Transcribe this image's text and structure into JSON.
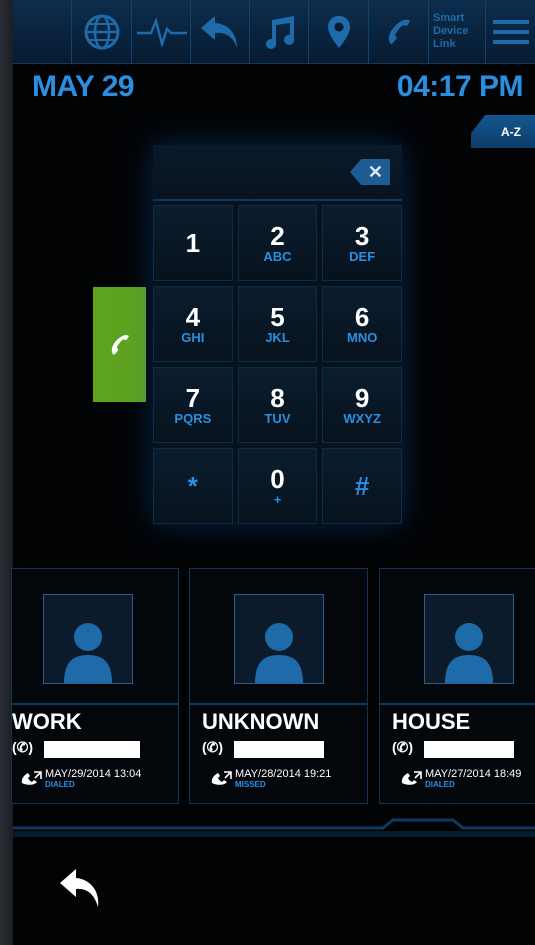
{
  "toolbar": {
    "items": [
      {
        "icon": "globe-icon"
      },
      {
        "icon": "pulse-icon"
      },
      {
        "icon": "undo-icon"
      },
      {
        "icon": "music-note-icon"
      },
      {
        "icon": "location-pin-icon"
      },
      {
        "icon": "phone-icon"
      },
      {
        "icon": "smart-device-link-icon",
        "label_lines": [
          "Smart",
          "Device",
          "Link"
        ]
      },
      {
        "icon": "menu-icon"
      }
    ]
  },
  "status": {
    "date": "MAY 29",
    "time": "04:17 PM"
  },
  "sort_button": {
    "label": "A-Z"
  },
  "keypad": {
    "display_value": "",
    "keys": [
      {
        "digit": "1",
        "letters": ""
      },
      {
        "digit": "2",
        "letters": "ABC"
      },
      {
        "digit": "3",
        "letters": "DEF"
      },
      {
        "digit": "4",
        "letters": "GHI"
      },
      {
        "digit": "5",
        "letters": "JKL"
      },
      {
        "digit": "6",
        "letters": "MNO"
      },
      {
        "digit": "7",
        "letters": "PQRS"
      },
      {
        "digit": "8",
        "letters": "TUV"
      },
      {
        "digit": "9",
        "letters": "WXYZ"
      },
      {
        "digit": "*",
        "letters": ""
      },
      {
        "digit": "0",
        "letters": "+"
      },
      {
        "digit": "#",
        "letters": ""
      }
    ]
  },
  "colors": {
    "accent": "#2a8fe0",
    "call_green": "#5ea31e",
    "topbar": "#0c2d4d"
  },
  "recents": [
    {
      "name": "WORK",
      "phone_prefix": "(✆)",
      "datetime": "MAY/29/2014 13:04",
      "status": "DIALED"
    },
    {
      "name": "UNKNOWN",
      "phone_prefix": "(✆)",
      "datetime": "MAY/28/2014 19:21",
      "status": "MISSED"
    },
    {
      "name": "HOUSE",
      "phone_prefix": "(✆)",
      "datetime": "MAY/27/2014 18:49",
      "status": "DIALED"
    }
  ]
}
